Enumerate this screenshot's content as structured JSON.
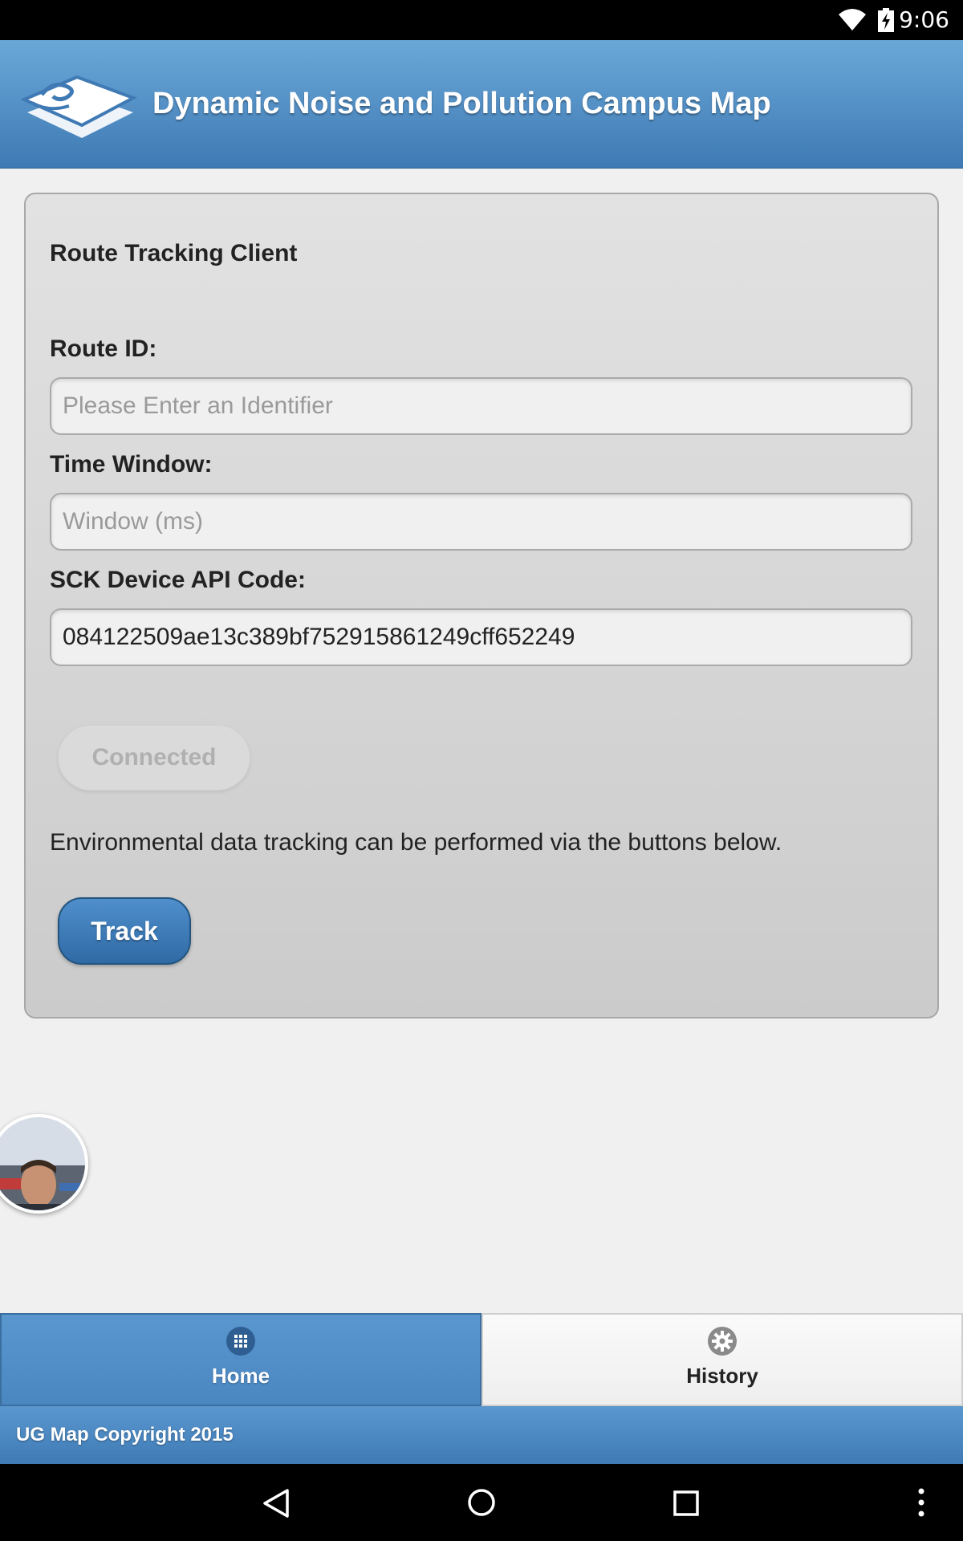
{
  "status_bar": {
    "time": "9:06"
  },
  "header": {
    "title": "Dynamic Noise and Pollution Campus Map"
  },
  "card": {
    "title": "Route Tracking Client",
    "route_id": {
      "label": "Route ID:",
      "value": "",
      "placeholder": "Please Enter an Identifier"
    },
    "time_window": {
      "label": "Time Window:",
      "value": "",
      "placeholder": "Window (ms)"
    },
    "api_code": {
      "label": "SCK Device API Code:",
      "value": "084122509ae13c389bf752915861249cff652249",
      "placeholder": ""
    },
    "connected_button": "Connected",
    "info_text": "Environmental data tracking can be performed via the buttons below.",
    "track_button": "Track"
  },
  "nav": {
    "home": {
      "label": "Home",
      "icon": "grid-icon",
      "active": true
    },
    "history": {
      "label": "History",
      "icon": "gear-icon",
      "active": false
    }
  },
  "footer": {
    "copyright": "UG Map Copyright 2015"
  },
  "colors": {
    "brand_blue": "#4a86c0",
    "header_light": "#6aa8d8",
    "track_button": "#2f6aa5"
  }
}
